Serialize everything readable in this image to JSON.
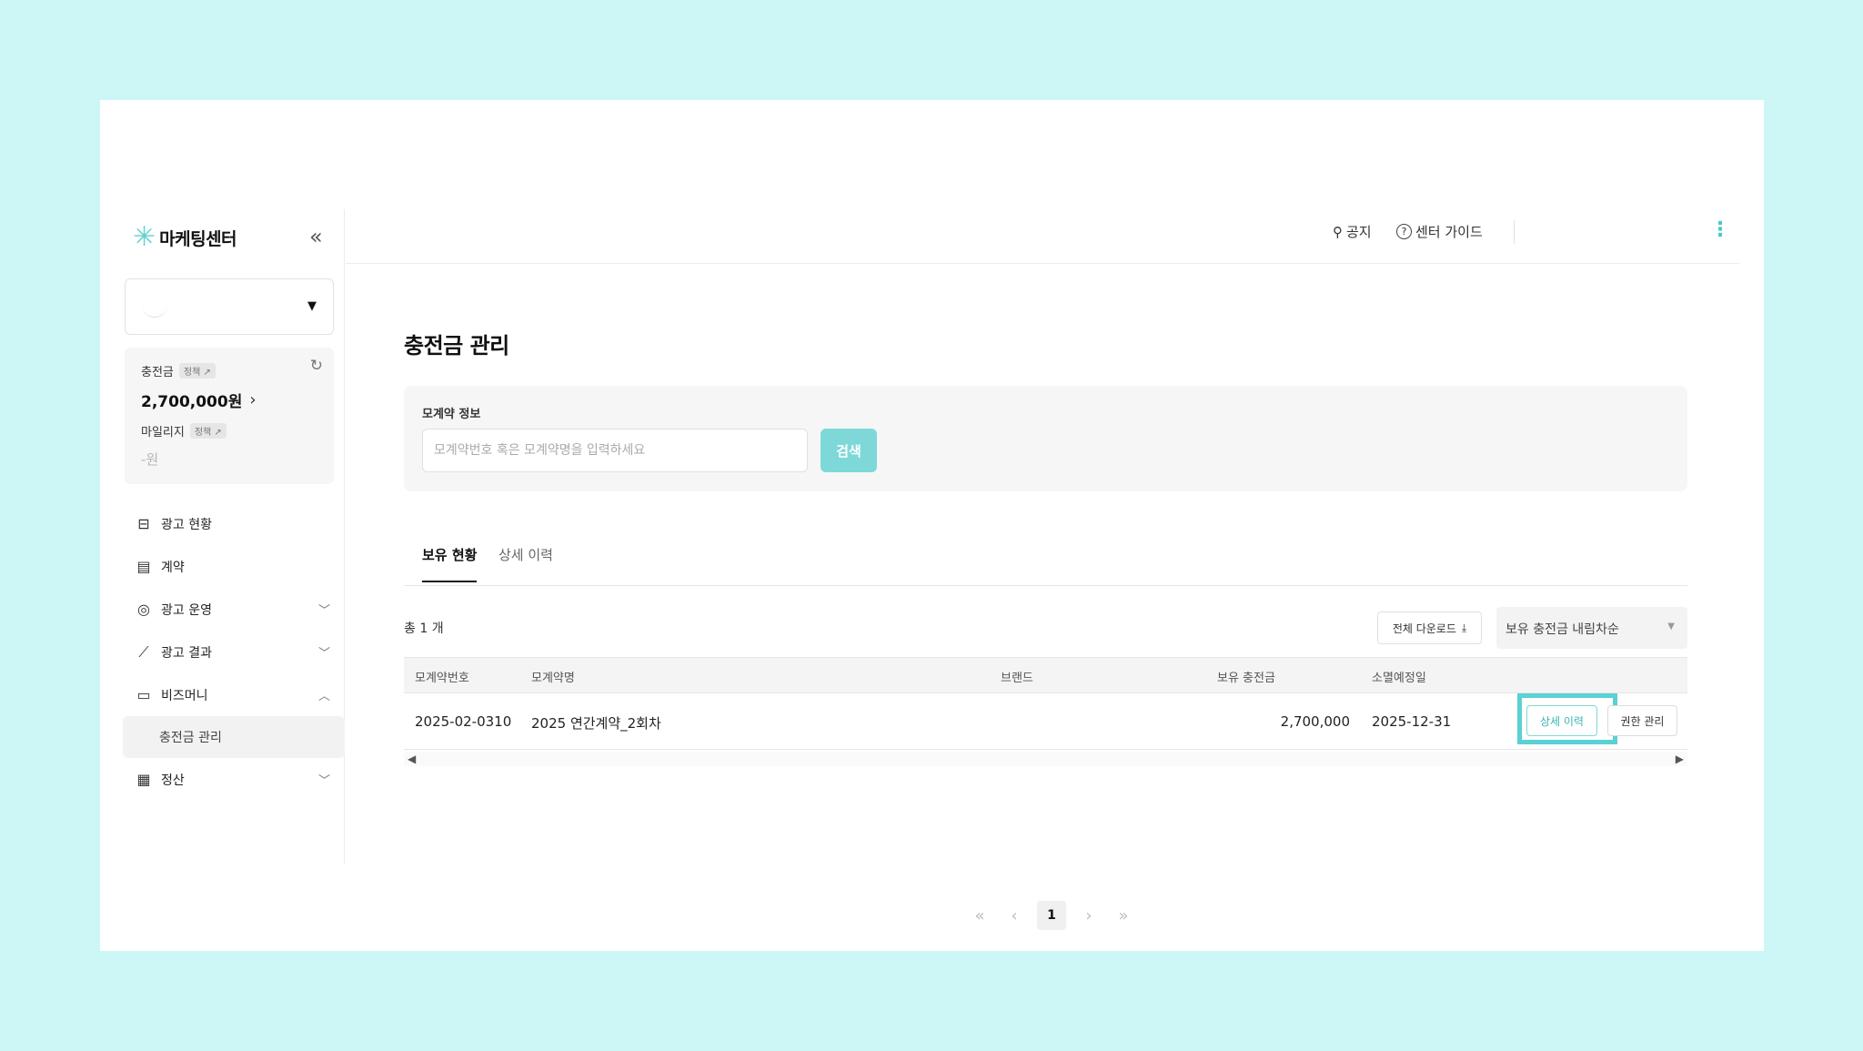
{
  "app": {
    "logo_text": "마케팅센터",
    "brand_color": "#5fd3d0",
    "accent_color": "#5ad1d4"
  },
  "header": {
    "notice_label": "공지",
    "guide_label": "센터 가이드"
  },
  "sidebar": {
    "charge": {
      "label": "충전금",
      "tag": "정책 ↗",
      "value": "2,700,000원"
    },
    "mileage": {
      "label": "마일리지",
      "tag": "정책 ↗",
      "value": "-원"
    },
    "items": [
      {
        "label": "광고 현황",
        "icon": "ad-status-icon"
      },
      {
        "label": "계약",
        "icon": "contract-icon"
      },
      {
        "label": "광고 운영",
        "icon": "ad-operation-icon",
        "expanded": false
      },
      {
        "label": "광고 결과",
        "icon": "ad-result-icon",
        "expanded": false
      },
      {
        "label": "비즈머니",
        "icon": "bizmoney-icon",
        "expanded": true,
        "children": [
          "충전금 관리"
        ]
      },
      {
        "label": "정산",
        "icon": "settlement-icon",
        "expanded": false
      }
    ]
  },
  "main": {
    "title": "충전금 관리",
    "search": {
      "label": "모계약 정보",
      "placeholder": "모계약번호 혹은 모계약명을 입력하세요",
      "button": "검색"
    },
    "tabs": [
      {
        "label": "보유 현황",
        "active": true
      },
      {
        "label": "상세 이력",
        "active": false
      }
    ],
    "total": "총 1 개",
    "download_label": "전체 다운로드",
    "sort_value": "보유 충전금 내림차순",
    "table": {
      "columns": [
        "모계약번호",
        "모계약명",
        "브랜드",
        "보유 충전금",
        "소멸예정일"
      ],
      "rows": [
        {
          "contract_no": "2025-02-0310",
          "contract_name": "2025 연간계약_2회차",
          "brand": "",
          "balance": "2,700,000",
          "expiry": "2025-12-31",
          "history_btn": "상세 이력",
          "perm_btn": "권한 관리"
        }
      ]
    },
    "pagination": {
      "current": "1"
    }
  }
}
